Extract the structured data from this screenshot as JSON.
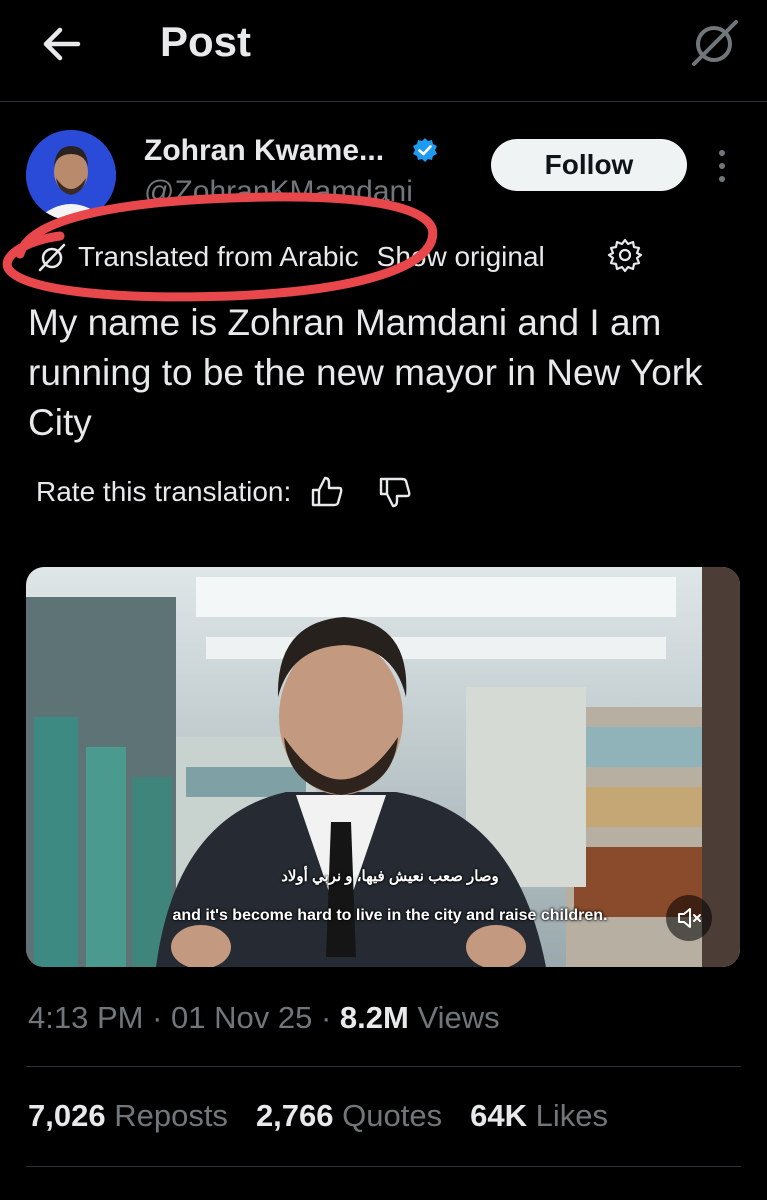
{
  "header": {
    "title": "Post",
    "back_icon": "arrow-left-icon",
    "grok_icon": "grok-icon"
  },
  "author": {
    "name": "Zohran Kwame...",
    "handle": "@ZohranKMamdani",
    "verified_color": "#1d9bf0",
    "follow_label": "Follow",
    "more_icon": "more-vertical-icon"
  },
  "translation": {
    "label": "Translated from Arabic",
    "show_original": "Show original",
    "icon": "grok-icon",
    "settings_icon": "gear-icon"
  },
  "post": {
    "text": "My name is Zohran Mamdani and I am running to be the new mayor in New York City"
  },
  "rating": {
    "label": "Rate this translation:",
    "up_icon": "thumbs-up-icon",
    "down_icon": "thumbs-down-icon"
  },
  "video": {
    "subtitle_arabic": "وصار صعب نعيش فيها، و نربي أولاد",
    "subtitle_english": "and it's become hard to live in the city and raise children.",
    "mute_icon": "volume-muted-icon"
  },
  "meta": {
    "time": "4:13 PM",
    "date": "01 Nov 25",
    "views_count": "8.2M",
    "views_label": "Views"
  },
  "stats": {
    "reposts_count": "7,026",
    "reposts_label": "Reposts",
    "quotes_count": "2,766",
    "quotes_label": "Quotes",
    "likes_count": "64K",
    "likes_label": "Likes"
  },
  "colors": {
    "background": "#000000",
    "text": "#e7e9ea",
    "secondary": "#71767b",
    "annotation": "#e8474b"
  }
}
